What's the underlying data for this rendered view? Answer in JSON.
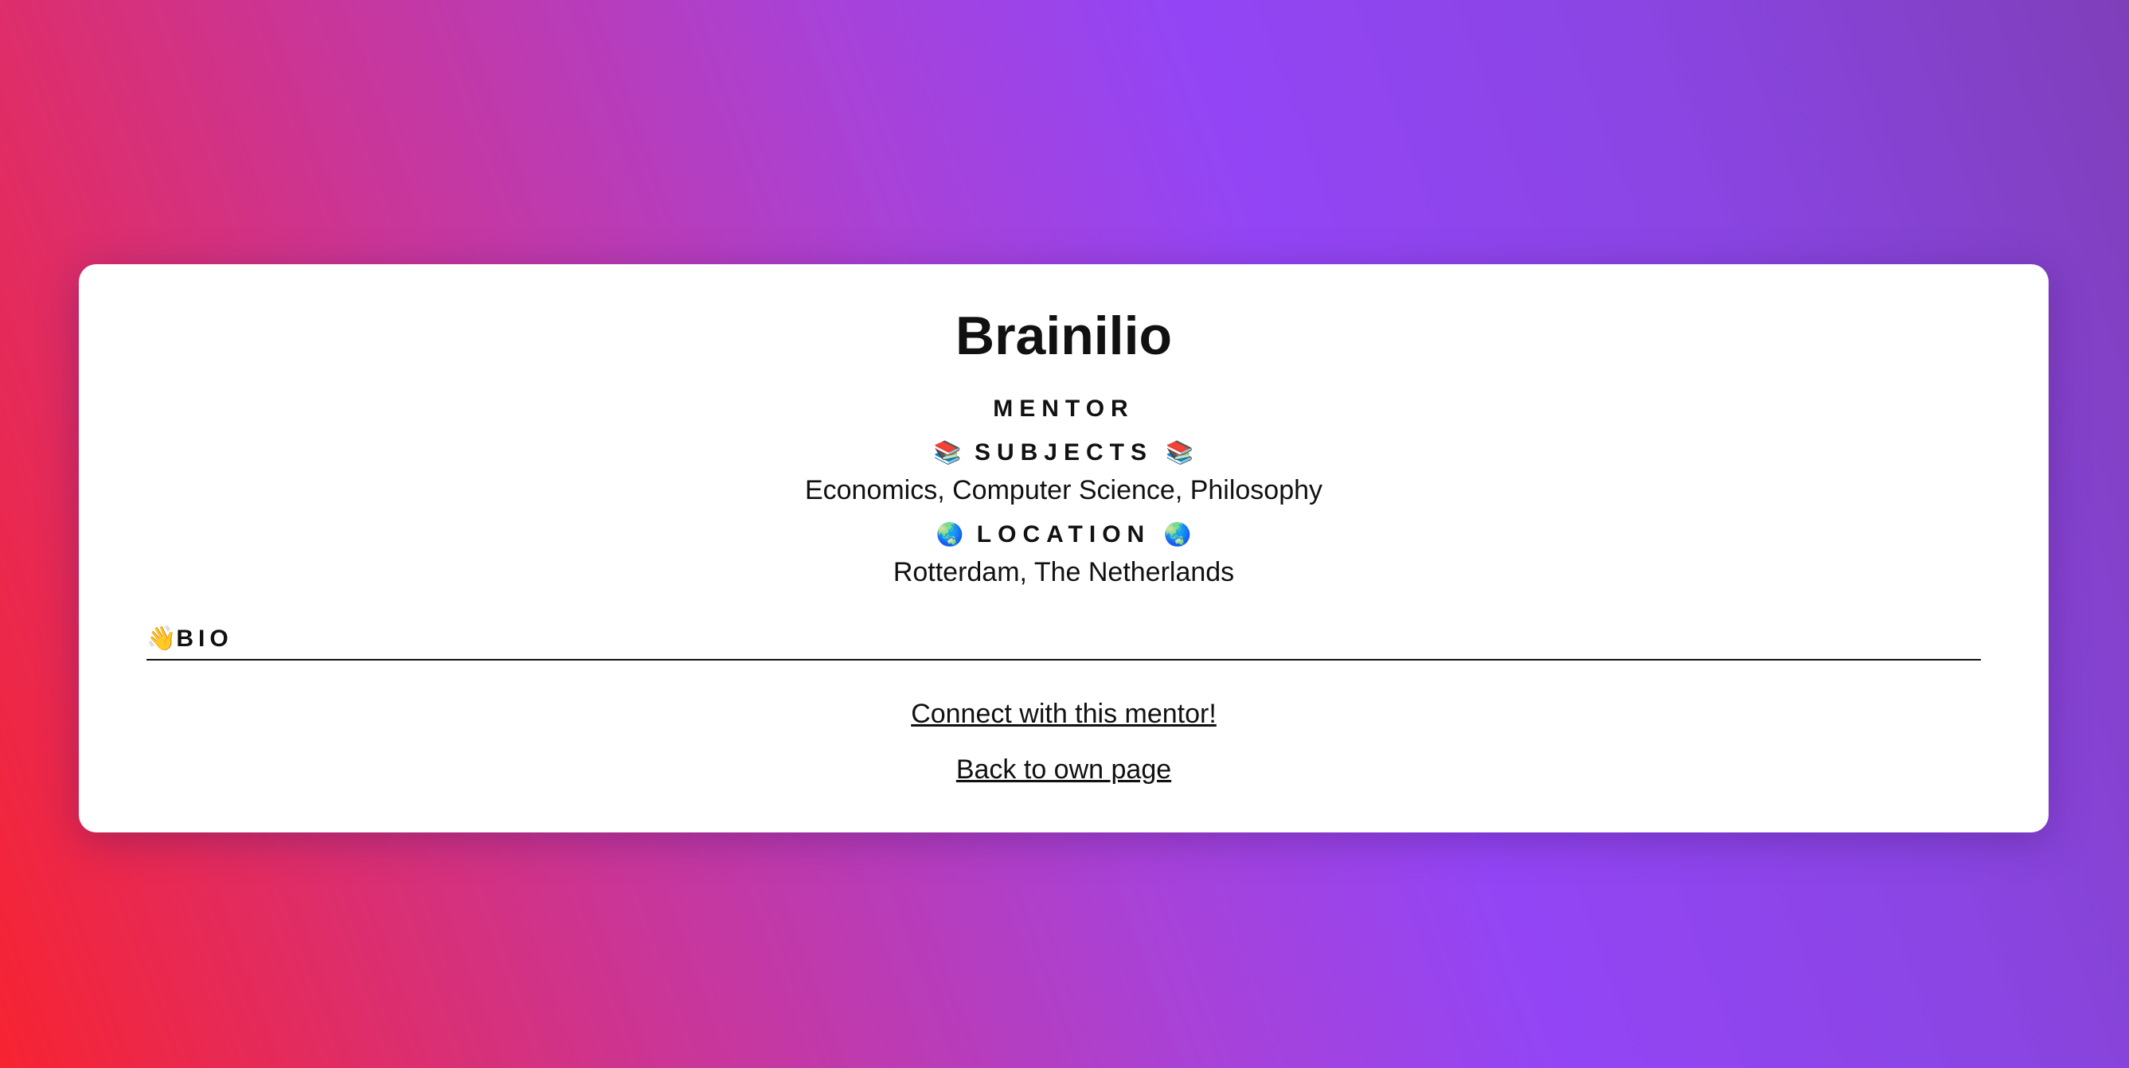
{
  "profile": {
    "name": "Brainilio",
    "role": "MENTOR",
    "subjects": {
      "label": "SUBJECTS",
      "emoji": "📚",
      "value": "Economics, Computer Science, Philosophy"
    },
    "location": {
      "label": "LOCATION",
      "emoji": "🌏",
      "value": "Rotterdam, The Netherlands"
    },
    "bio": {
      "label": "BIO",
      "emoji": "👋"
    }
  },
  "actions": {
    "connect_label": "Connect with this mentor!",
    "back_label": "Back to own page"
  },
  "colors": {
    "background_gradient": [
      "#f72331",
      "#c9369a",
      "#9345f5",
      "#7f3fba"
    ],
    "card": "#ffffff",
    "text": "#111111"
  }
}
